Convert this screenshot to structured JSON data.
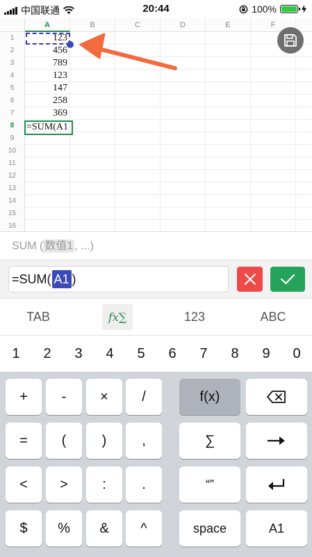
{
  "status_bar": {
    "carrier": "中国联通",
    "time": "20:44",
    "battery": "100%",
    "battery_level": 1.0
  },
  "sheet": {
    "columns": [
      "A",
      "B",
      "C",
      "D",
      "E",
      "F"
    ],
    "row_numbers": [
      "1",
      "2",
      "3",
      "4",
      "5",
      "6",
      "7",
      "8",
      "9",
      "10",
      "11",
      "12",
      "13",
      "14",
      "15",
      "16"
    ],
    "values": [
      "123",
      "456",
      "789",
      "123",
      "147",
      "258",
      "369"
    ],
    "active_cell_text": "=SUM(A1",
    "active_column": "A",
    "active_row": "8"
  },
  "formula_hint": {
    "fn": "SUM (",
    "arg": "数值1",
    "rest": ", ...)"
  },
  "input": {
    "prefix": "=SUM(",
    "ref": "A1",
    "suffix": ")"
  },
  "keyboard_tabs": [
    "TAB",
    "fx∑",
    "123",
    "ABC"
  ],
  "digits": [
    "1",
    "2",
    "3",
    "4",
    "5",
    "6",
    "7",
    "8",
    "9",
    "0"
  ],
  "keys": {
    "row1": [
      "+",
      "-",
      "×",
      "/",
      "f(x)"
    ],
    "row2": [
      "=",
      "(",
      ")",
      ",",
      "∑"
    ],
    "row3": [
      "<",
      ">",
      ":",
      ".",
      "“”"
    ],
    "row4": [
      "$",
      "%",
      "&",
      "^",
      "space",
      "A1"
    ]
  },
  "colors": {
    "accent_green": "#1f8a4c",
    "ref_blue": "#3a49b8",
    "cancel_red": "#ef4a4a",
    "ok_green": "#26a35a",
    "arrow_orange": "#f26a3d"
  },
  "icons": {
    "save": "save-icon",
    "cancel": "close-icon",
    "confirm": "check-icon",
    "backspace": "backspace-icon",
    "arrow": "arrow-right-icon",
    "enter": "enter-icon"
  }
}
